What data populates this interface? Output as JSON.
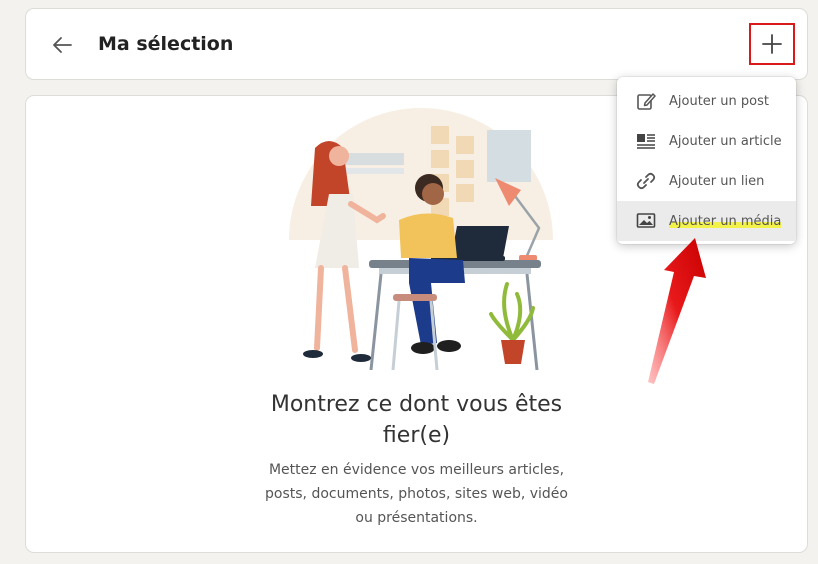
{
  "header": {
    "title": "Ma sélection",
    "back_icon": "arrow-left-icon",
    "add_icon": "plus-icon"
  },
  "menu": {
    "items": [
      {
        "label": "Ajouter un post",
        "icon": "edit-icon"
      },
      {
        "label": "Ajouter un article",
        "icon": "article-icon"
      },
      {
        "label": "Ajouter un lien",
        "icon": "link-icon"
      },
      {
        "label": "Ajouter un média",
        "icon": "image-icon",
        "highlighted": true
      }
    ]
  },
  "empty_state": {
    "title_line1": "Montrez ce dont vous êtes",
    "title_line2": "fier(e)",
    "desc_line1": "Mettez en évidence vos meilleurs articles,",
    "desc_line2": "posts, documents, photos, sites web, vidéo",
    "desc_line3": "ou présentations."
  },
  "colors": {
    "annotation_red": "#d91a1a",
    "highlight_yellow": "#f2f24a",
    "background": "#f3f2ef"
  }
}
